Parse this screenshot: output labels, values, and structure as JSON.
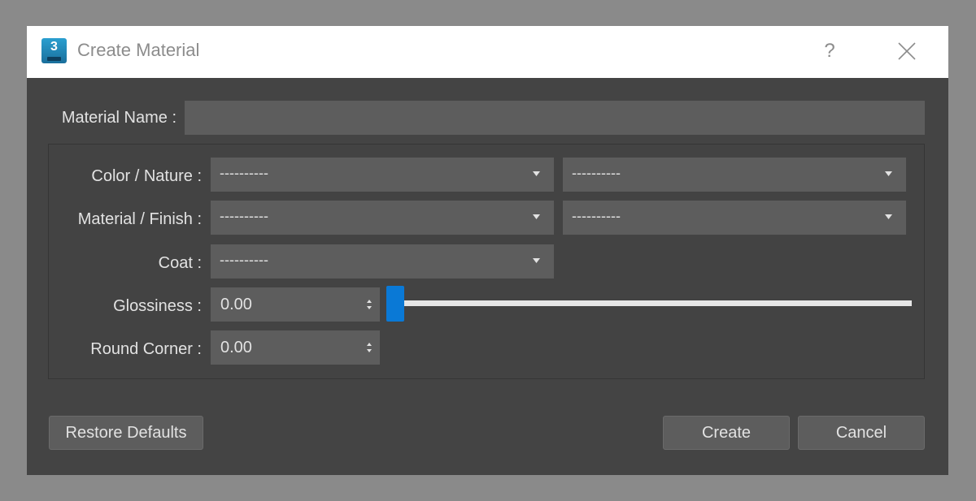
{
  "window": {
    "title": "Create Material",
    "app_icon_label": "3",
    "help_label": "?"
  },
  "form": {
    "material_name": {
      "label": "Material Name :",
      "value": ""
    },
    "color_nature": {
      "label": "Color / Nature :",
      "primary": "----------",
      "secondary": "----------"
    },
    "material_finish": {
      "label": "Material / Finish :",
      "primary": "----------",
      "secondary": "----------"
    },
    "coat": {
      "label": "Coat :",
      "value": "----------"
    },
    "glossiness": {
      "label": "Glossiness :",
      "value": "0.00",
      "slider_fraction": 0
    },
    "round_corner": {
      "label": "Round Corner :",
      "value": "0.00"
    }
  },
  "buttons": {
    "restore_defaults": "Restore Defaults",
    "create": "Create",
    "cancel": "Cancel"
  },
  "colors": {
    "accent": "#0a79d6",
    "dialog_bg": "#444444",
    "field_bg": "#5d5d5d"
  }
}
